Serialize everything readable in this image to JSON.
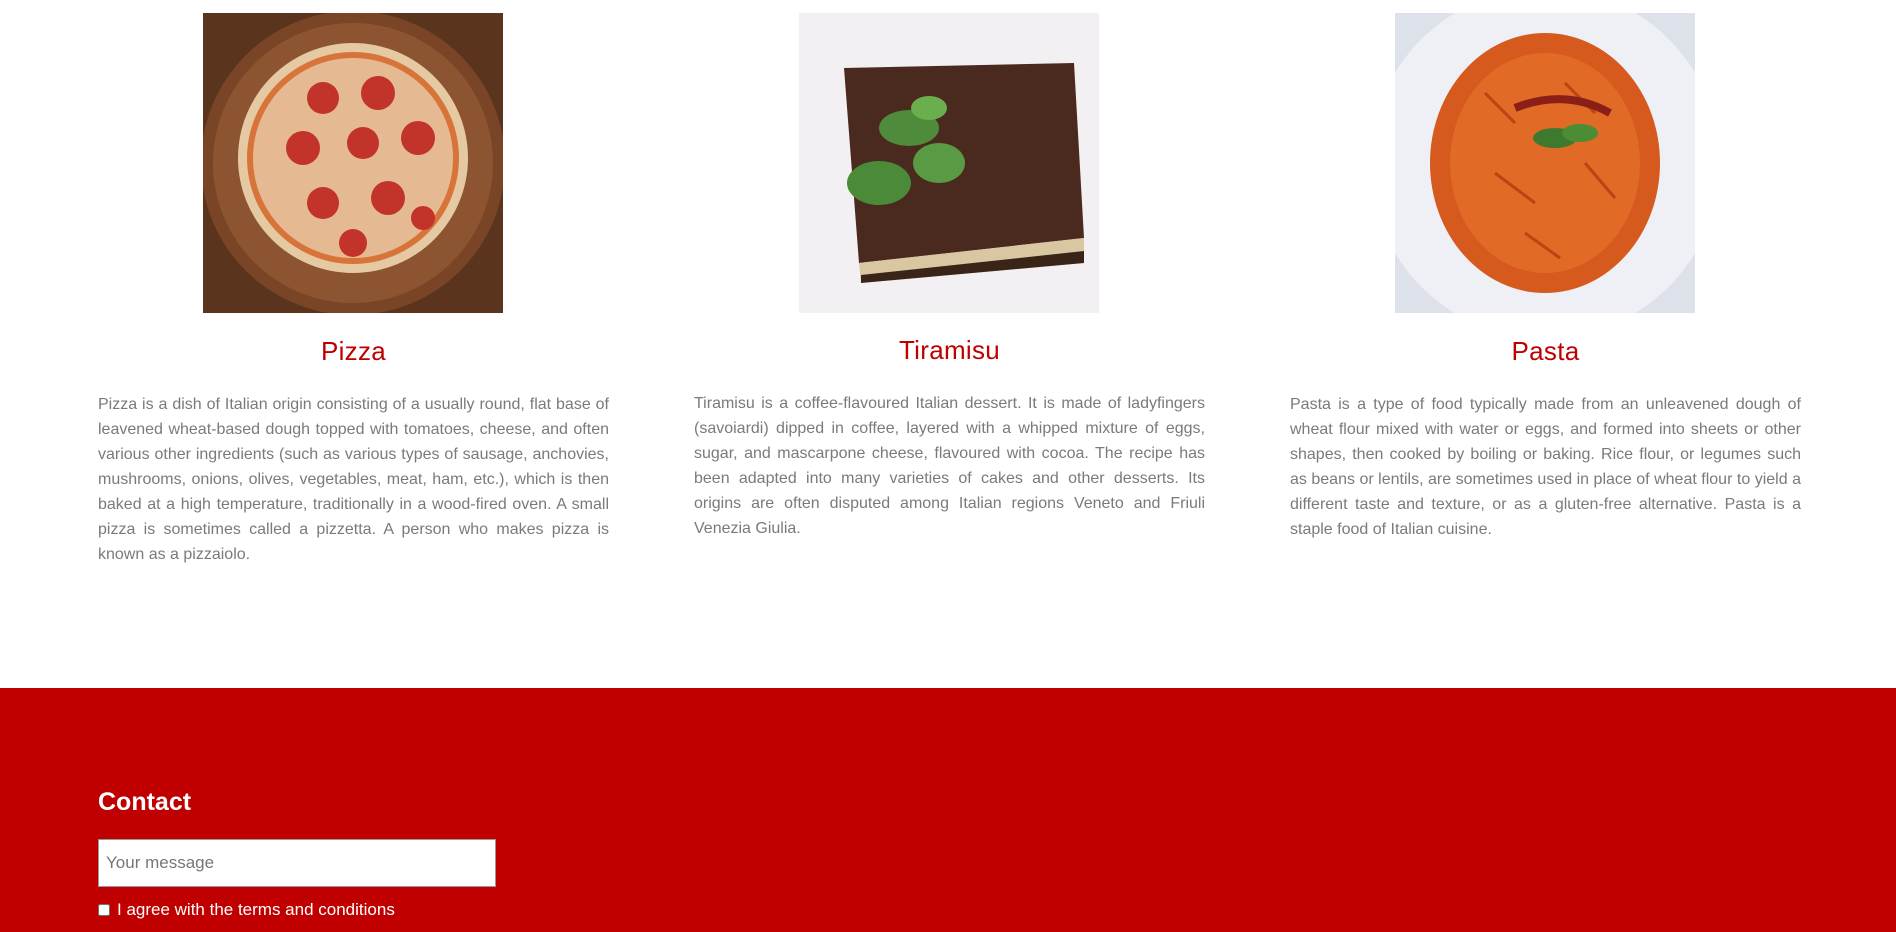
{
  "dishes": [
    {
      "name": "Pizza",
      "description": "Pizza is a dish of Italian origin consisting of a usually round, flat base of leavened wheat-based dough topped with tomatoes, cheese, and often various other ingredients (such as various types of sausage, anchovies, mushrooms, onions, olives, vegetables, meat, ham, etc.), which is then baked at a high temperature, traditionally in a wood-fired oven. A small pizza is sometimes called a pizzetta. A person who makes pizza is known as a pizzaiolo."
    },
    {
      "name": "Tiramisu",
      "description": "Tiramisu is a coffee-flavoured Italian dessert. It is made of ladyfingers (savoiardi) dipped in coffee, layered with a whipped mixture of eggs, sugar, and mascarpone cheese, flavoured with cocoa. The recipe has been adapted into many varieties of cakes and other desserts. Its origins are often disputed among Italian regions Veneto and Friuli Venezia Giulia."
    },
    {
      "name": "Pasta",
      "description": "Pasta is a type of food typically made from an unleavened dough of wheat flour mixed with water or eggs, and formed into sheets or other shapes, then cooked by boiling or baking. Rice flour, or legumes such as beans or lentils, are sometimes used in place of wheat flour to yield a different taste and texture, or as a gluten-free alternative. Pasta is a staple food of Italian cuisine."
    }
  ],
  "contact": {
    "title": "Contact",
    "message_placeholder": "Your message",
    "message_value": "",
    "agree_label": "I agree with the terms and conditions",
    "agree_checked": false
  },
  "colors": {
    "accent": "#c00000",
    "body_text": "#7a7a7a",
    "footer_text": "#ffffff"
  }
}
